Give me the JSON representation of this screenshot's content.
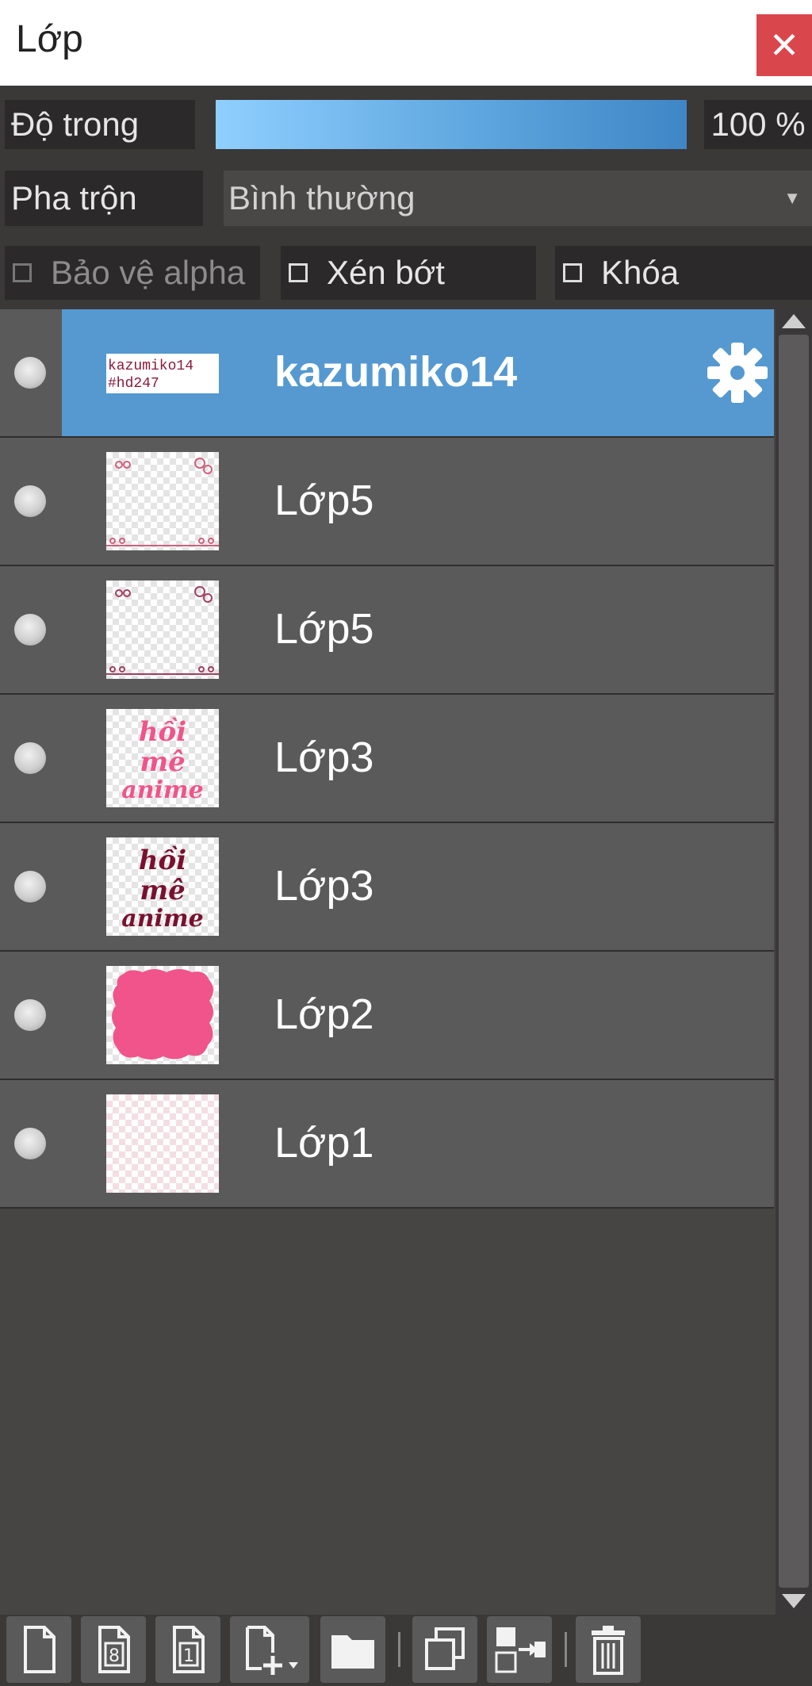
{
  "panel": {
    "title": "Lớp",
    "close_symbol": "✕"
  },
  "opacity": {
    "label": "Độ trong",
    "value_text": "100 %",
    "value": 1.0
  },
  "blend": {
    "label": "Pha trộn",
    "value": "Bình thường"
  },
  "options": {
    "protect_alpha": "Bảo vệ alpha",
    "clip": "Xén bớt",
    "lock": "Khóa"
  },
  "layers": [
    {
      "name": "kazumiko14",
      "selected": true,
      "thumb_text": [
        "kazumiko14",
        "#hd247"
      ]
    },
    {
      "name": "Lớp5",
      "selected": false
    },
    {
      "name": "Lớp5",
      "selected": false
    },
    {
      "name": "Lớp3",
      "selected": false,
      "thumb_text": [
        "hồi",
        "mê",
        "anime"
      ]
    },
    {
      "name": "Lớp3",
      "selected": false,
      "thumb_text": [
        "hồi",
        "mê",
        "anime"
      ]
    },
    {
      "name": "Lớp2",
      "selected": false
    },
    {
      "name": "Lớp1",
      "selected": false
    }
  ],
  "toolbar": {
    "icons": [
      "new-layer-icon",
      "new-8bit-layer-icon",
      "new-1bit-layer-icon",
      "add-layer-menu-icon",
      "new-folder-icon",
      "duplicate-layer-icon",
      "merge-down-icon",
      "delete-layer-icon"
    ],
    "badge_8": "8",
    "badge_1": "1"
  },
  "colors": {
    "selected_row": "#5599d0",
    "close_button": "#d9464c",
    "thumb_pink": "#f0548a",
    "thumb_maroon": "#7a1030"
  }
}
